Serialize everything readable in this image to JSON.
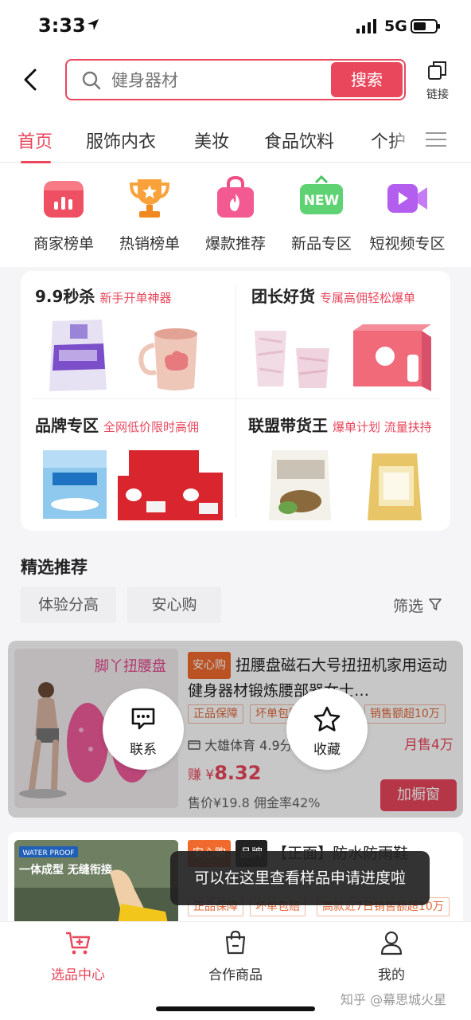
{
  "status_bar": {
    "time": "3:33",
    "network": "5G"
  },
  "header": {
    "back_icon": "chevron-left-icon",
    "search_placeholder": "健身器材",
    "search_button": "搜索",
    "link_label": "链接"
  },
  "tabs": [
    {
      "label": "首页",
      "active": true
    },
    {
      "label": "服饰内衣",
      "active": false
    },
    {
      "label": "美妆",
      "active": false
    },
    {
      "label": "食品饮料",
      "active": false
    },
    {
      "label": "个护",
      "active": false
    }
  ],
  "categories": [
    {
      "label": "商家榜单",
      "icon": "shop-chart-icon"
    },
    {
      "label": "热销榜单",
      "icon": "trophy-icon"
    },
    {
      "label": "爆款推荐",
      "icon": "shopping-bag-fire-icon"
    },
    {
      "label": "新品专区",
      "icon": "new-badge-icon"
    },
    {
      "label": "短视频专区",
      "icon": "video-camera-icon"
    }
  ],
  "promos": [
    {
      "title": "9.9秒杀",
      "subtitle": "新手开单神器"
    },
    {
      "title": "团长好货",
      "subtitle": "专属高佣轻松爆单"
    },
    {
      "title": "品牌专区",
      "subtitle": "全网低价限时高佣"
    },
    {
      "title": "联盟带货王",
      "subtitle": "爆单计划 流量扶持"
    }
  ],
  "section": {
    "title": "精选推荐",
    "chips": [
      "体验分高",
      "安心购"
    ],
    "filter_label": "筛选"
  },
  "product1": {
    "image_caption": "脚丫扭腰盘",
    "badge": "安心购",
    "title": "扭腰盘磁石大号扭扭机家用运动健身器材锻炼腰部器女士…",
    "tags": [
      "正品保障",
      "坏单包赔",
      "销售额超10万"
    ],
    "shop": "大雄体育 4.9分",
    "monthly_sales": "月售4万",
    "earn_prefix": "赚 ¥",
    "earn_value": "8.32",
    "price_line": "售价¥19.8  佣金率42%",
    "add_button": "加橱窗",
    "contact_label": "联系",
    "favorite_label": "收藏"
  },
  "product2": {
    "image_tag": "WATER PROOF",
    "image_caption": "一体成型 无缝衔接",
    "badge1": "安心购",
    "badge2": "品牌",
    "title": "【正面】防水防雨鞋",
    "tags": [
      "正品保障",
      "坏单包赔",
      "高款近7日销售额超10万"
    ]
  },
  "toast": "可以在这里查看样品申请进度啦",
  "bottom_nav": [
    {
      "label": "选品中心",
      "icon": "cart-plus-icon",
      "active": true
    },
    {
      "label": "合作商品",
      "icon": "bag-icon",
      "active": false
    },
    {
      "label": "我的",
      "icon": "user-icon",
      "active": false
    }
  ],
  "watermark": "知乎 @幕思城火星"
}
